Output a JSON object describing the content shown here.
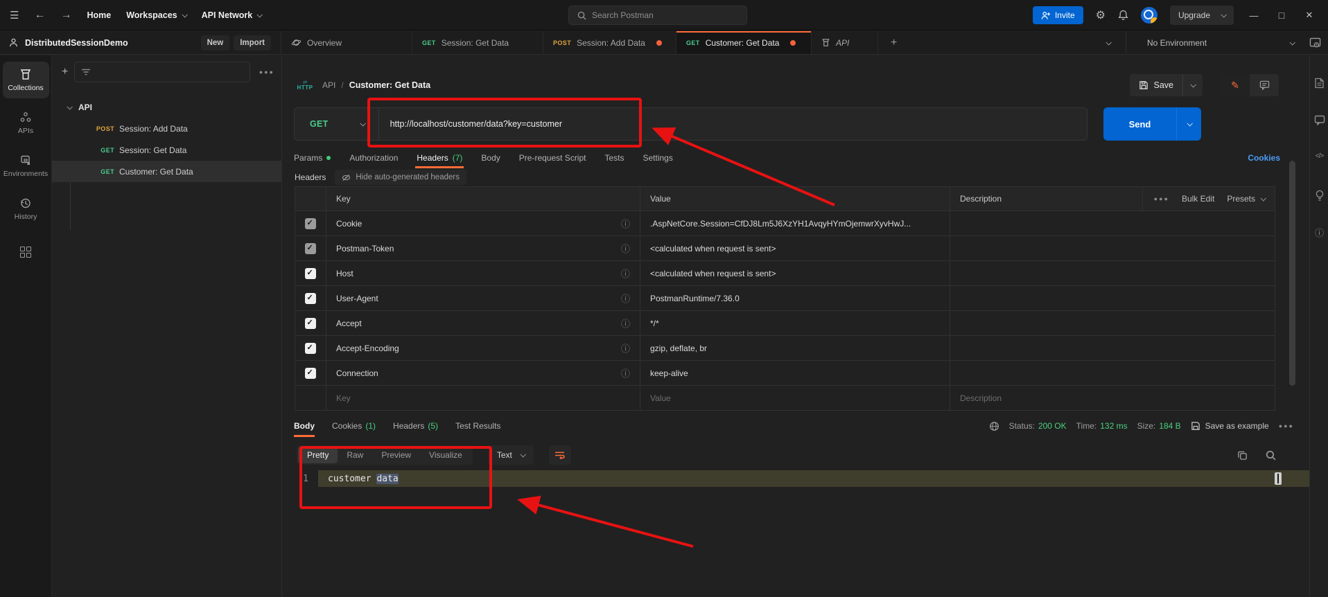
{
  "colors": {
    "accent_orange": "#ff6c37",
    "primary_blue": "#0265d2",
    "method_get_green": "#49cc8b",
    "method_post_yellow": "#e0a53f",
    "success_green": "#4ad07e",
    "link_blue": "#4a9df8",
    "annotation_red": "#e81212"
  },
  "topbar": {
    "menu": [
      {
        "label": "Home"
      },
      {
        "label": "Workspaces"
      },
      {
        "label": "API Network"
      }
    ],
    "search_placeholder": "Search Postman",
    "invite_label": "Invite",
    "upgrade_label": "Upgrade"
  },
  "workspace_bar": {
    "workspace_name": "DistributedSessionDemo",
    "new_label": "New",
    "import_label": "Import",
    "tabs": [
      {
        "label": "Overview"
      },
      {
        "method": "GET",
        "label": "Session: Get Data"
      },
      {
        "method": "POST",
        "label": "Session: Add Data"
      },
      {
        "method": "GET",
        "label": "Customer: Get Data"
      },
      {
        "label": "API"
      }
    ],
    "environment_selector": "No Environment"
  },
  "sidebar": {
    "items": [
      {
        "label": "Collections"
      },
      {
        "label": "APIs"
      },
      {
        "label": "Environments"
      },
      {
        "label": "History"
      }
    ]
  },
  "collections_panel": {
    "root_name": "API",
    "requests": [
      {
        "method": "POST",
        "name": "Session: Add Data"
      },
      {
        "method": "GET",
        "name": "Session: Get Data"
      },
      {
        "method": "GET",
        "name": "Customer: Get Data"
      }
    ]
  },
  "request": {
    "breadcrumb": {
      "icon_label": "HTTP",
      "root": "API",
      "separator": "/",
      "name": "Customer: Get Data"
    },
    "method": "GET",
    "url": "http://localhost/customer/data?key=customer",
    "save_label": "Save",
    "send_label": "Send",
    "tabs": [
      {
        "label": "Params"
      },
      {
        "label": "Authorization"
      },
      {
        "label": "Headers",
        "count": "(7)"
      },
      {
        "label": "Body"
      },
      {
        "label": "Pre-request Script"
      },
      {
        "label": "Tests"
      },
      {
        "label": "Settings"
      }
    ],
    "cookies_link": "Cookies",
    "headers_section_title": "Headers",
    "hide_autogen_label": "Hide auto-generated headers",
    "table": {
      "columns": {
        "key": "Key",
        "value": "Value",
        "description": "Description"
      },
      "bulk_edit_label": "Bulk Edit",
      "presets_label": "Presets",
      "rows": [
        {
          "key": "Cookie",
          "value": ".AspNetCore.Session=CfDJ8Lm5J6XzYH1AvqyHYmOjemwrXyvHwJ..."
        },
        {
          "key": "Postman-Token",
          "value": "<calculated when request is sent>"
        },
        {
          "key": "Host",
          "value": "<calculated when request is sent>"
        },
        {
          "key": "User-Agent",
          "value": "PostmanRuntime/7.36.0"
        },
        {
          "key": "Accept",
          "value": "*/*"
        },
        {
          "key": "Accept-Encoding",
          "value": "gzip, deflate, br"
        },
        {
          "key": "Connection",
          "value": "keep-alive"
        }
      ],
      "placeholder_row": {
        "key": "Key",
        "value": "Value",
        "description": "Description"
      }
    }
  },
  "response": {
    "tabs": [
      {
        "label": "Body"
      },
      {
        "label": "Cookies",
        "count": "(1)"
      },
      {
        "label": "Headers",
        "count": "(5)"
      },
      {
        "label": "Test Results"
      }
    ],
    "meta": {
      "status_label": "Status:",
      "status_value": "200 OK",
      "time_label": "Time:",
      "time_value": "132 ms",
      "size_label": "Size:",
      "size_value": "184 B",
      "save_example_label": "Save as example"
    },
    "toolbar": {
      "views": [
        "Pretty",
        "Raw",
        "Preview",
        "Visualize"
      ],
      "format": "Text"
    },
    "body_line": {
      "number": "1",
      "text": "customer ",
      "selected_text": "data"
    }
  }
}
